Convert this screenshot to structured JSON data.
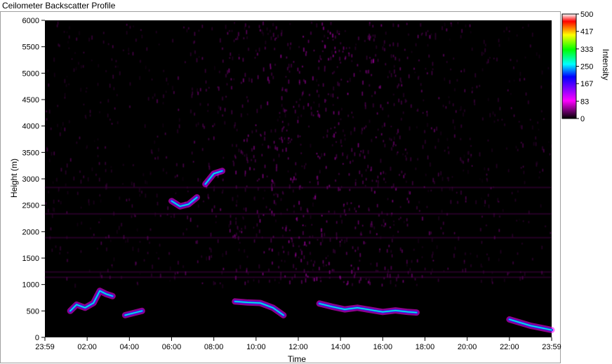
{
  "window": {
    "title": "Ceilometer Backscatter Profile"
  },
  "chart_data": {
    "type": "heatmap",
    "title": "Ceilometer Backscatter Profile",
    "xlabel": "Time",
    "ylabel": "Height (m)",
    "colorbar_label": "Intensity",
    "x_ticks": [
      "23:59",
      "02:00",
      "04:00",
      "06:00",
      "08:00",
      "10:00",
      "12:00",
      "14:00",
      "16:00",
      "18:00",
      "20:00",
      "22:00",
      "23:59"
    ],
    "y_ticks": [
      0,
      500,
      1000,
      1500,
      2000,
      2500,
      3000,
      3500,
      4000,
      4500,
      5000,
      5500,
      6000
    ],
    "ylim": [
      0,
      6000
    ],
    "colorbar_ticks": [
      0,
      83,
      167,
      250,
      333,
      417,
      500
    ],
    "colorbar_range": [
      0,
      500
    ],
    "colorscale": [
      "#000000",
      "#ff00ff",
      "#0000ff",
      "#00ffff",
      "#00ff00",
      "#ffff00",
      "#ff0000",
      "#ffffff"
    ],
    "features": [
      {
        "name": "early layer",
        "points": [
          [
            1.2,
            500
          ],
          [
            1.5,
            620
          ],
          [
            1.9,
            560
          ],
          [
            2.3,
            650
          ],
          [
            2.6,
            880
          ],
          [
            2.9,
            820
          ],
          [
            3.2,
            780
          ]
        ]
      },
      {
        "name": "early cluster",
        "points": [
          [
            3.8,
            420
          ],
          [
            4.2,
            460
          ],
          [
            4.6,
            500
          ]
        ]
      },
      {
        "name": "elevated layer",
        "points": [
          [
            6.0,
            2580
          ],
          [
            6.4,
            2480
          ],
          [
            6.8,
            2520
          ],
          [
            7.2,
            2650
          ]
        ]
      },
      {
        "name": "rising layer",
        "points": [
          [
            7.6,
            2900
          ],
          [
            8.0,
            3100
          ],
          [
            8.4,
            3150
          ]
        ]
      },
      {
        "name": "midday layer",
        "points": [
          [
            9.0,
            680
          ],
          [
            9.6,
            660
          ],
          [
            10.2,
            650
          ],
          [
            10.8,
            560
          ],
          [
            11.3,
            420
          ]
        ]
      },
      {
        "name": "afternoon layer",
        "points": [
          [
            13.0,
            640
          ],
          [
            13.6,
            580
          ],
          [
            14.2,
            530
          ],
          [
            14.8,
            560
          ],
          [
            15.4,
            520
          ],
          [
            16.0,
            480
          ],
          [
            16.6,
            510
          ],
          [
            17.2,
            480
          ],
          [
            17.6,
            470
          ]
        ]
      },
      {
        "name": "night layer",
        "points": [
          [
            22.0,
            340
          ],
          [
            22.5,
            280
          ],
          [
            23.0,
            220
          ],
          [
            23.5,
            180
          ],
          [
            24.0,
            140
          ]
        ]
      }
    ]
  }
}
